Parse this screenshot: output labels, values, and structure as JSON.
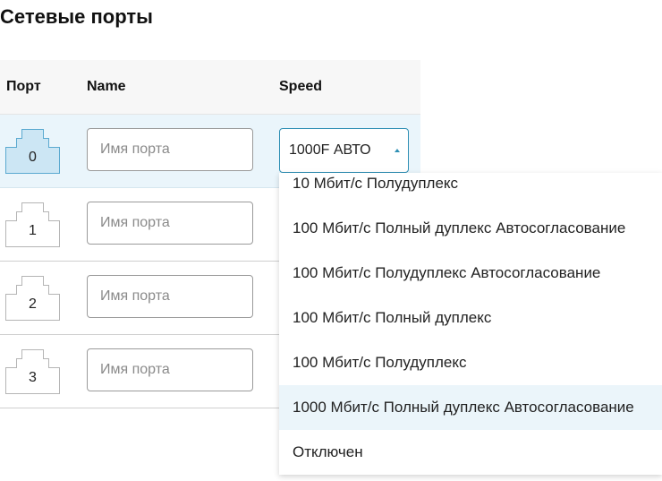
{
  "page_title": "Сетевые порты",
  "table": {
    "headers": {
      "port": "Порт",
      "name": "Name",
      "speed": "Speed"
    },
    "rows": [
      {
        "port": "0",
        "name_placeholder": "Имя порта",
        "speed": "1000F АВТО",
        "selected": true
      },
      {
        "port": "1",
        "name_placeholder": "Имя порта"
      },
      {
        "port": "2",
        "name_placeholder": "Имя порта"
      },
      {
        "port": "3",
        "name_placeholder": "Имя порта"
      }
    ]
  },
  "speed_dropdown": {
    "options": [
      "10 Мбит/с Полудуплекс",
      "100 Мбит/с Полный дуплекс Автосогласование",
      "100 Мбит/с Полудуплекс Автосогласование",
      "100 Мбит/с Полный дуплекс",
      "100 Мбит/с Полудуплекс",
      "1000 Мбит/с Полный дуплекс Автосогласование",
      "Отключен"
    ],
    "highlighted_index": 5
  },
  "colors": {
    "accent": "#2e8fb4",
    "selected_row_bg": "#eaf5fb",
    "selected_port_fill": "#cce6f4",
    "selected_port_stroke": "#5aa9d0",
    "port_stroke": "#b5b5b5",
    "header_bg": "#f7f7f7",
    "highlight_bg": "#ebf5fa"
  },
  "icons": {
    "port": "ethernet-port-icon",
    "caret": "caret-up-icon"
  }
}
